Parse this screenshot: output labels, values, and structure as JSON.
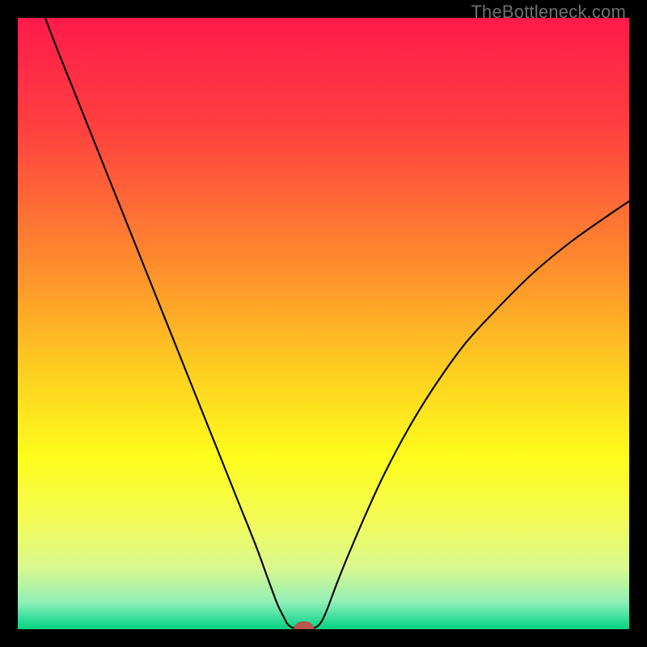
{
  "watermark": "TheBottleneck.com",
  "chart_data": {
    "type": "line",
    "title": "",
    "xlabel": "",
    "ylabel": "",
    "xlim": [
      0,
      100
    ],
    "ylim": [
      0,
      100
    ],
    "gradient_stops": [
      {
        "offset": 0.0,
        "color": "#ff1a4b"
      },
      {
        "offset": 0.18,
        "color": "#ff4040"
      },
      {
        "offset": 0.4,
        "color": "#fe8b2e"
      },
      {
        "offset": 0.58,
        "color": "#fecf20"
      },
      {
        "offset": 0.72,
        "color": "#fdfd1c"
      },
      {
        "offset": 0.82,
        "color": "#f3fb55"
      },
      {
        "offset": 0.9,
        "color": "#d9f88f"
      },
      {
        "offset": 0.955,
        "color": "#93efb7"
      },
      {
        "offset": 0.985,
        "color": "#2fdd99"
      },
      {
        "offset": 1.0,
        "color": "#07d281"
      }
    ],
    "series": [
      {
        "name": "curve",
        "x": [
          0,
          3,
          6,
          9,
          12,
          15,
          18,
          21,
          24,
          27,
          30,
          33,
          36,
          39,
          41,
          42.5,
          43.5,
          44,
          44.5,
          45.3,
          48.3,
          49.5,
          50.5,
          52,
          54,
          57,
          60,
          64,
          68,
          73,
          78,
          84,
          90,
          96,
          100
        ],
        "y": [
          112,
          104,
          96,
          88.5,
          81,
          73.5,
          66,
          58.5,
          51,
          43.5,
          36,
          28.5,
          21,
          13.5,
          8,
          4,
          2,
          1,
          0.5,
          0.2,
          0.2,
          1,
          3,
          7,
          12,
          19,
          25.5,
          33,
          39.5,
          46.5,
          52,
          58,
          63,
          67.3,
          70
        ]
      }
    ],
    "marker": {
      "x": 46.8,
      "y": 0.2,
      "rx": 1.6,
      "ry": 1.1,
      "color": "#b7574e"
    }
  }
}
